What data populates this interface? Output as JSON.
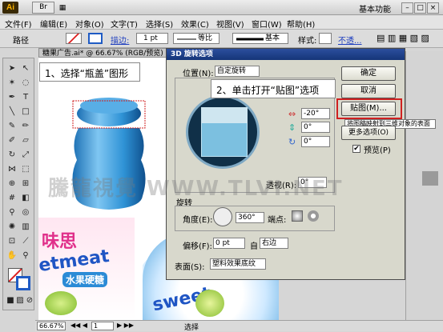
{
  "app": {
    "logo": "Ai",
    "bridge": "Br",
    "workspace": "基本功能"
  },
  "menu": [
    "文件(F)",
    "编辑(E)",
    "对象(O)",
    "文字(T)",
    "选择(S)",
    "效果(C)",
    "视图(V)",
    "窗口(W)",
    "帮助(H)"
  ],
  "controlbar": {
    "path_label": "路径",
    "stroke_label": "描边:",
    "stroke_value": "1 pt",
    "profile": "等比",
    "brush": "基本",
    "style_label": "样式:",
    "opacity_label": "不透..."
  },
  "document": {
    "tab": "糖果广告.ai* @ 66.67% (RGB/预览)",
    "callout1": "1、选择“瓶盖”图形"
  },
  "dialog": {
    "title": "3D 旋转选项",
    "position_label": "位置(N):",
    "position_value": "自定旋转",
    "callout2": "2、单击打开“贴图”选项",
    "ok": "确定",
    "cancel": "取消",
    "map": "贴图(M)...",
    "more": "更多选项(O)",
    "preview": "预览(P)",
    "tooltip": "将图稿映射到三维对象的表面",
    "angle_x": "-20°",
    "angle_y": "0°",
    "angle_z": "0°",
    "perspective_label": "透视(R):",
    "perspective_value": "0°",
    "rotate_section": "旋转",
    "angle_label": "角度(E):",
    "angle_value": "360°",
    "cap_label": "端点:",
    "offset_label": "偏移(F):",
    "offset_value": "0 pt",
    "from_label": "自",
    "from_value": "右边",
    "surface_label": "表面(S):",
    "surface_value": "塑料效果底纹"
  },
  "artwork": {
    "brand1": "味思",
    "brand2": "etmeat",
    "brand3": "水果硬糖",
    "brand4": "sweet",
    "watermark": "騰龍視覺 WWW.TLVI.NET"
  },
  "status": {
    "zoom": "66.67%",
    "page": "1",
    "mode": "选择"
  },
  "colors": {
    "accent": "#1f5bc4",
    "highlight_box": "#d02020",
    "bottle": "#2f93d6"
  }
}
